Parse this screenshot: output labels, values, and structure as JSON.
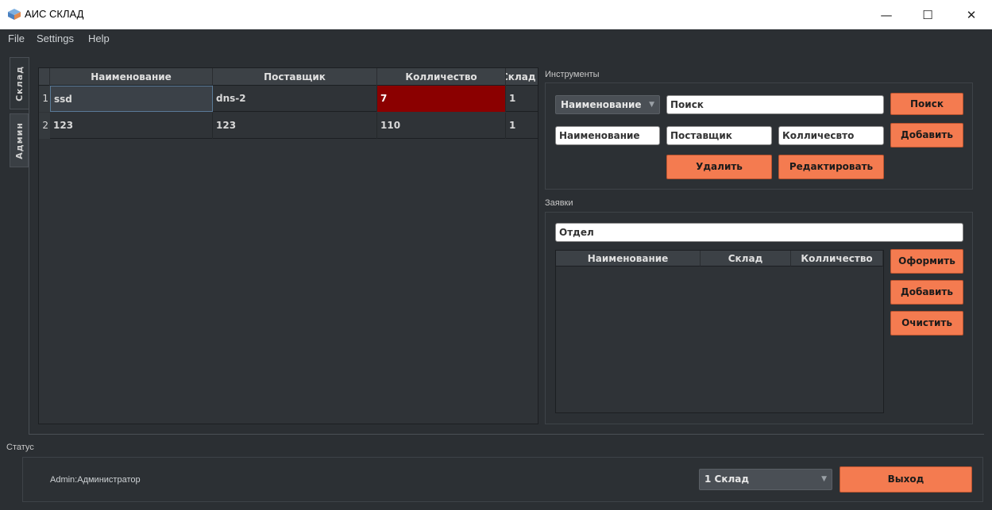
{
  "window": {
    "title": "АИС СКЛАД",
    "minimize_icon": "minimize-icon",
    "maximize_icon": "maximize-icon",
    "close_icon": "close-icon"
  },
  "menu": {
    "file": "File",
    "settings": "Settings",
    "help": "Help"
  },
  "tabs": [
    {
      "label": "Склад"
    },
    {
      "label": "Админ"
    }
  ],
  "stock_table": {
    "headers": [
      "Наименование",
      "Поставщик",
      "Колличество",
      "Склад"
    ],
    "rows": [
      {
        "num": "1",
        "name": "ssd",
        "supplier": "dns-2",
        "qty": "7",
        "warehouse": "1"
      },
      {
        "num": "2",
        "name": "123",
        "supplier": "123",
        "qty": "110",
        "warehouse": "1"
      }
    ]
  },
  "tools": {
    "title": "Инструменты",
    "filter_combo": "Наименование",
    "search_value": "Поиск",
    "search_button": "Поиск",
    "name_field": "Наименование",
    "supplier_field": "Поставщик",
    "qty_field": "Колличесвто",
    "add_button": "Добавить",
    "delete_button": "Удалить",
    "edit_button": "Редактировать"
  },
  "requests": {
    "title": "Заявки",
    "department_field": "Отдел",
    "headers": [
      "Наименование",
      "Склад",
      "Колличество"
    ],
    "submit_button": "Оформить",
    "add_button": "Добавить",
    "clear_button": "Очистить"
  },
  "status": {
    "title": "Статус",
    "user": "Admin:Администратор",
    "warehouse_select": "1 Склад",
    "exit_button": "Выход"
  },
  "colors": {
    "accent": "#f47b50",
    "highlight_cell": "#8b0000",
    "background": "#2b2f33"
  }
}
